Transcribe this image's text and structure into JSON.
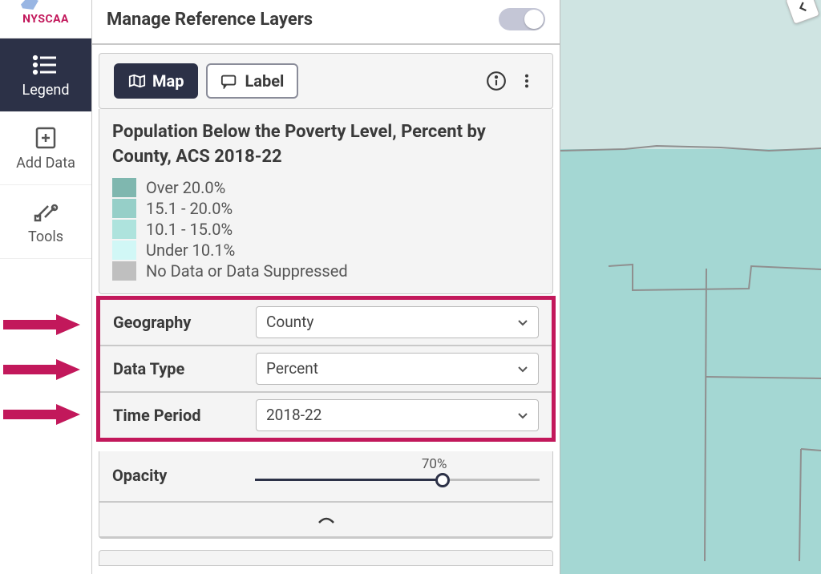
{
  "logo": {
    "text": "NYSCAA"
  },
  "sidebar": {
    "legend": {
      "label": "Legend"
    },
    "adddata": {
      "label": "Add Data"
    },
    "tools": {
      "label": "Tools"
    }
  },
  "panel": {
    "title": "Manage Reference Layers",
    "tabs": {
      "map": "Map",
      "label": "Label"
    },
    "layer": {
      "title": "Population Below the Poverty Level, Percent by County, ACS 2018-22",
      "legend": [
        {
          "label": "Over 20.0%",
          "color": "#7fb7af"
        },
        {
          "label": "15.1 - 20.0%",
          "color": "#96cfc8"
        },
        {
          "label": "10.1 - 15.0%",
          "color": "#aee3dd"
        },
        {
          "label": "Under 10.1%",
          "color": "#d1f7f6"
        },
        {
          "label": "No Data or Data Suppressed",
          "color": "#bfbfbf"
        }
      ]
    },
    "filters": {
      "geography": {
        "label": "Geography",
        "value": "County"
      },
      "datatype": {
        "label": "Data Type",
        "value": "Percent"
      },
      "timeperiod": {
        "label": "Time Period",
        "value": "2018-22"
      }
    },
    "opacity": {
      "label": "Opacity",
      "value_pct": "70%",
      "value_num": 70
    },
    "accent": "#c2185b",
    "nav_bg": "#2c3147"
  }
}
